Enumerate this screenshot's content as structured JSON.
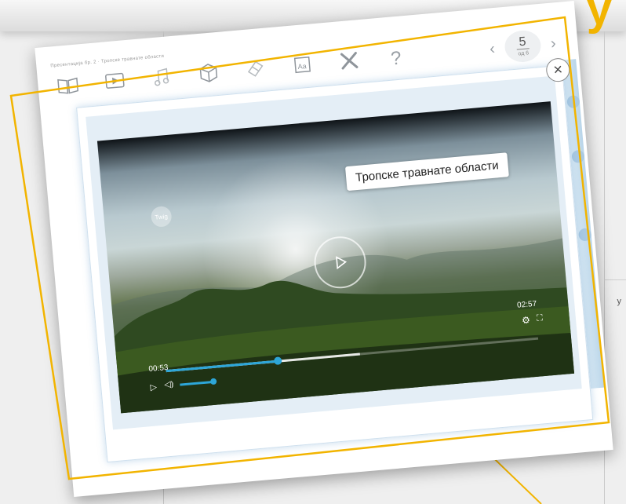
{
  "colors": {
    "accent_blue": "#2da6d8",
    "highlight_yellow": "#f2b400",
    "icon_gray": "#9aa0a6"
  },
  "background": {
    "heading_fragment": "у",
    "side_note": "у"
  },
  "window": {
    "breadcrumb": "Пресентација бр. 2 · Тропске травнате области",
    "toolbar": [
      {
        "icon": "book-icon"
      },
      {
        "icon": "video-play-icon"
      },
      {
        "icon": "music-note-icon"
      },
      {
        "icon": "cube-icon"
      },
      {
        "icon": "eraser-icon"
      },
      {
        "icon": "text-size-icon",
        "label": "Aa"
      },
      {
        "icon": "tools-icon"
      },
      {
        "icon": "help-icon",
        "label": "?"
      }
    ],
    "pager": {
      "prev": "‹",
      "next": "›",
      "current": "5",
      "total": "од 6"
    }
  },
  "modal": {
    "close_label": "×"
  },
  "video": {
    "title": "Тропске травнате области",
    "brand": "Twig",
    "current_time": "00:53",
    "total_time": "02:57",
    "progress": 0.3,
    "buffered": 0.52,
    "volume": 1.0
  }
}
